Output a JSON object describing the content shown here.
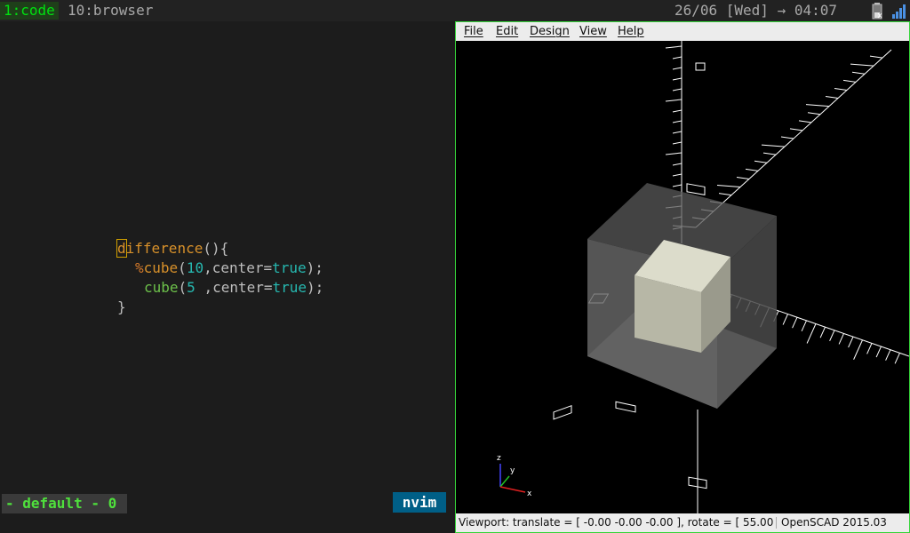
{
  "workspaces": [
    {
      "label": "1:code",
      "active": true
    },
    {
      "label": "10:browser",
      "active": false
    }
  ],
  "clock": "26/06 [Wed] → 04:07",
  "tray": {
    "icons": [
      "battery-icon",
      "network-signal-icon"
    ]
  },
  "editor": {
    "lines": {
      "l1": {
        "first": "d",
        "rest": "ifference",
        "tail": "(){"
      },
      "l2": {
        "mod": "%",
        "fn": "cube",
        "open": "(",
        "num": "10",
        "mid": ",center=",
        "kw": "true",
        "close": ");"
      },
      "l3": {
        "fn": "cube",
        "open": "(",
        "num": "5",
        "mid": " ,center=",
        "kw": "true",
        "close": ");"
      },
      "l4": "}"
    },
    "status_left": "- default - 0",
    "status_right": "nvim"
  },
  "openscad": {
    "menu": [
      "File",
      "Edit",
      "Design",
      "View",
      "Help"
    ],
    "viewport_text": "Viewport: translate = [ -0.00 -0.00 -0.00 ], rotate = [ 55.00",
    "version": "OpenSCAD 2015.03",
    "axis_labels": {
      "x": "x",
      "y": "y",
      "z": "z"
    },
    "colors": {
      "outer_cube": "#8c8c8c",
      "inner_cube": "#d8d8c6",
      "axes": "#ffffff",
      "border": "#36d43a"
    }
  }
}
